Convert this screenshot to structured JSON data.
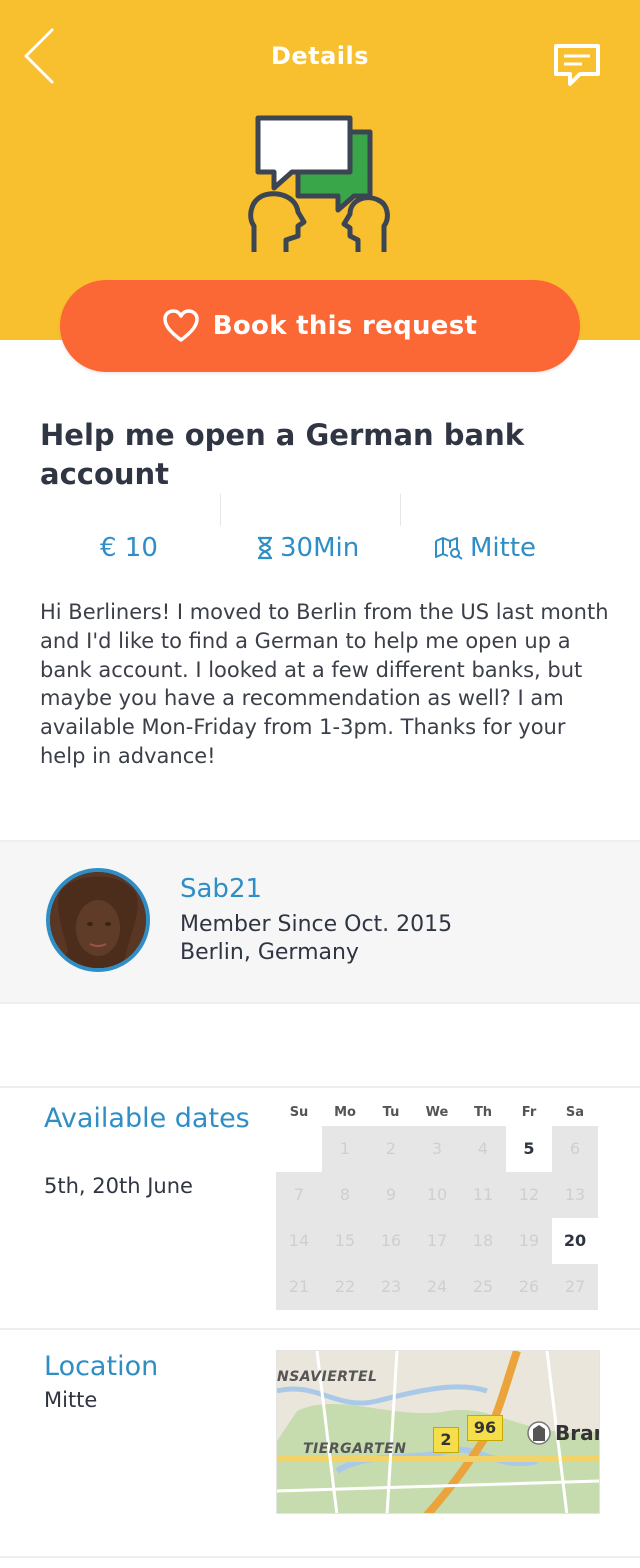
{
  "header": {
    "title": "Details",
    "back_icon": "chevron-left-icon",
    "chat_icon": "chat-icon",
    "background": "#f8bf2e"
  },
  "book_button": {
    "label": "Book this request",
    "icon": "heart-icon",
    "color": "#fb6836"
  },
  "request": {
    "title": "Help me open a German bank account",
    "price": "€ 10",
    "duration": "30Min",
    "location": "Mitte",
    "description": "Hi Berliners! I moved to Berlin from the US last month and I'd like to find a German to help me open up a bank account. I looked at a few different banks, but maybe you have a recommendation as well? I am available Mon-Friday from 1-3pm. Thanks for your help in advance!"
  },
  "member": {
    "username": "Sab21",
    "since": "Member Since Oct. 2015",
    "city": "Berlin, Germany"
  },
  "available": {
    "title": "Available dates",
    "dates": "5th, 20th June",
    "weekdays": [
      "Su",
      "Mo",
      "Tu",
      "We",
      "Th",
      "Fr",
      "Sa"
    ],
    "days": [
      "",
      "1",
      "2",
      "3",
      "4",
      "5",
      "6",
      "7",
      "8",
      "9",
      "10",
      "11",
      "12",
      "13",
      "14",
      "15",
      "16",
      "17",
      "18",
      "19",
      "20",
      "21",
      "22",
      "23",
      "24",
      "25",
      "26",
      "27"
    ],
    "highlighted": [
      "5",
      "20"
    ]
  },
  "location": {
    "title": "Location",
    "value": "Mitte",
    "map": {
      "district1": "NSAVIERTEL",
      "district2": "TIERGARTEN",
      "road1": "2",
      "road2": "96",
      "city": "Brar"
    }
  },
  "accent_color": "#2f8ec5"
}
